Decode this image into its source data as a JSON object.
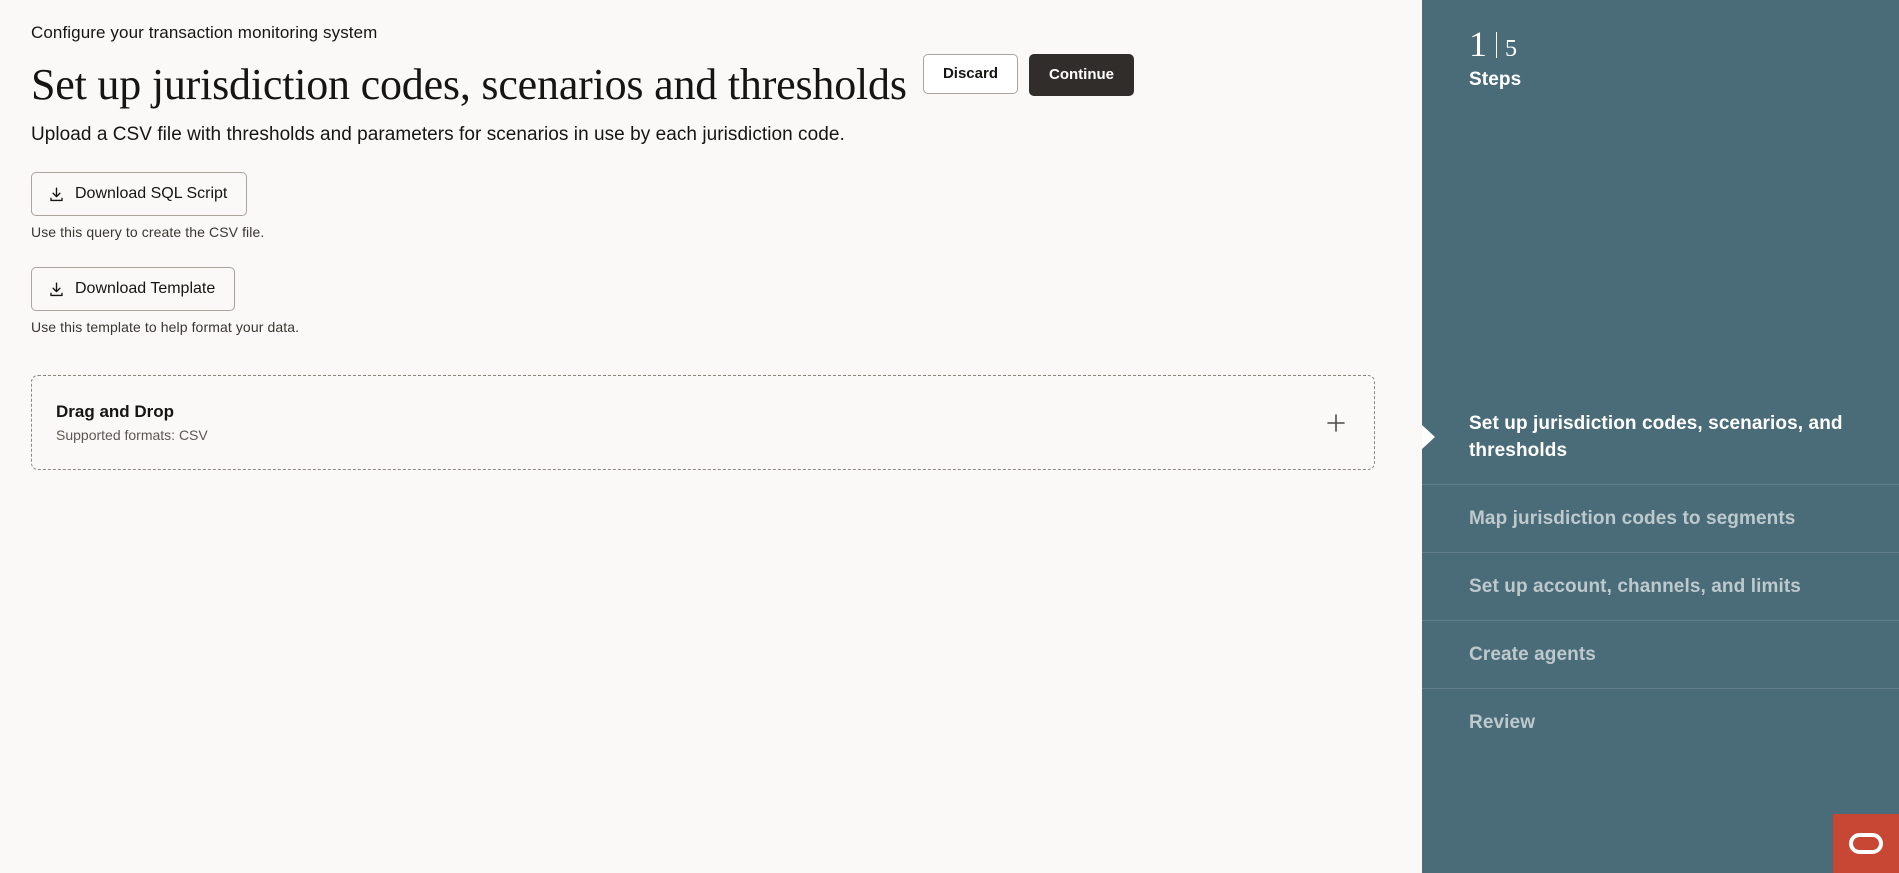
{
  "main": {
    "breadcrumb": "Configure your transaction monitoring system",
    "title": "Set up jurisdiction codes, scenarios and thresholds",
    "subtitle": "Upload a CSV file with thresholds and parameters for scenarios in use by each jurisdiction code.",
    "actions": {
      "discard_label": "Discard",
      "continue_label": "Continue"
    },
    "downloads": [
      {
        "label": "Download SQL Script",
        "helper": "Use this query to create the CSV file.",
        "icon": "download-icon"
      },
      {
        "label": "Download Template",
        "helper": "Use this template to help format your data.",
        "icon": "download-icon"
      }
    ],
    "dropzone": {
      "title": "Drag and Drop",
      "subtitle": "Supported formats: CSV",
      "add_icon": "plus-icon"
    }
  },
  "sidebar": {
    "current_step": "1",
    "total_steps": "5",
    "steps_label": "Steps",
    "steps": [
      {
        "label": "Set up jurisdiction codes, scenarios, and thresholds",
        "active": true
      },
      {
        "label": "Map jurisdiction codes to segments",
        "active": false
      },
      {
        "label": "Set up account, channels, and limits",
        "active": false
      },
      {
        "label": "Create agents",
        "active": false
      },
      {
        "label": "Review",
        "active": false
      }
    ]
  },
  "chat_widget": {
    "icon": "oracle-logo-icon"
  },
  "colors": {
    "page_background": "#faf9f8",
    "sidebar_background": "#4a6c78",
    "sidebar_divider": "#5f7e89",
    "primary_button": "#312d2a",
    "accent_red": "#c74634",
    "text_primary": "#161513",
    "text_muted": "#5c5751",
    "step_inactive": "#bdc9cd"
  }
}
